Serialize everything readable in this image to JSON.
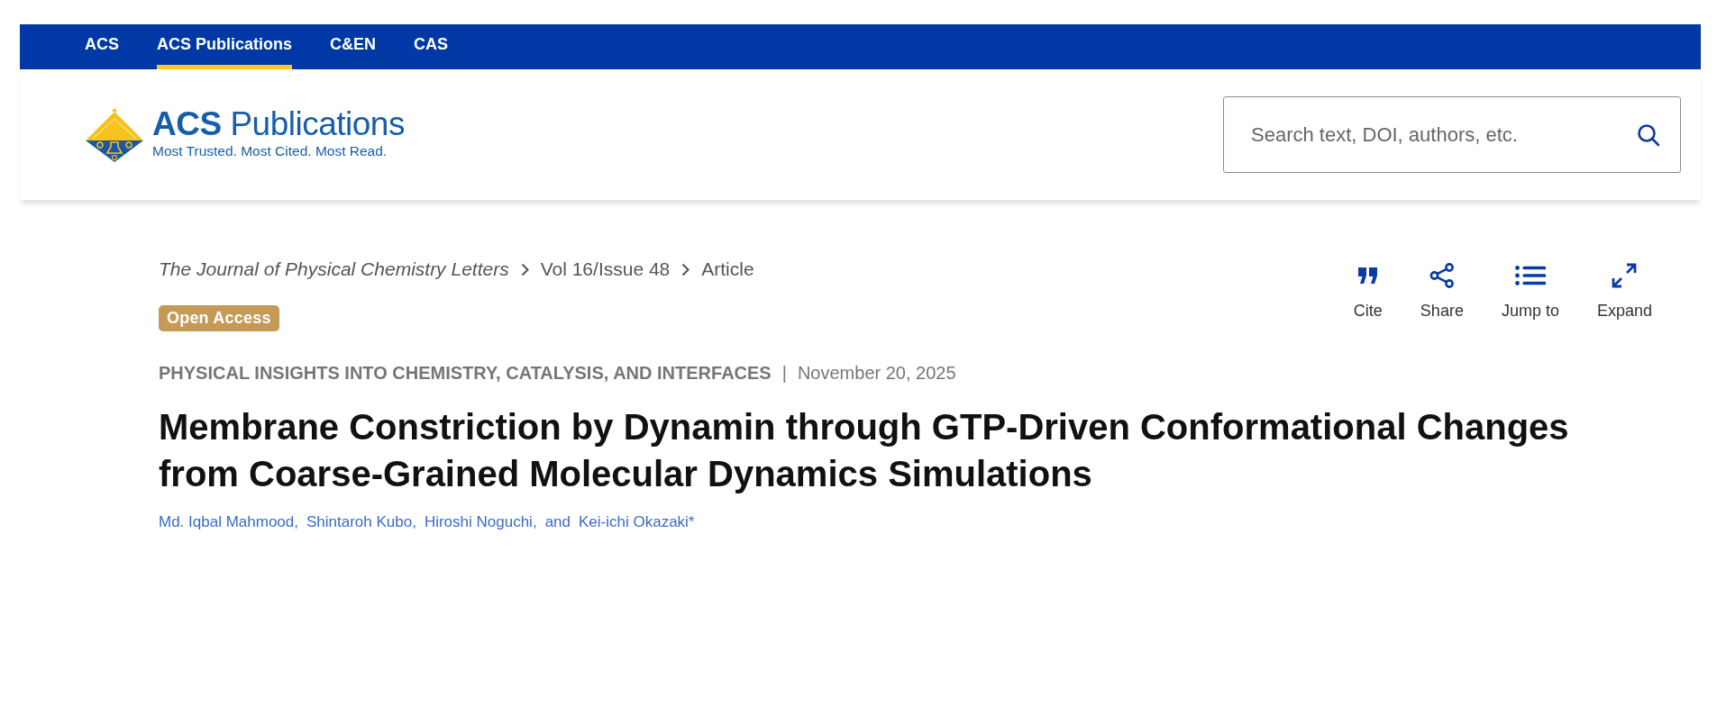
{
  "top_nav": [
    {
      "label": "ACS",
      "selected": false
    },
    {
      "label": "ACS Publications",
      "selected": true
    },
    {
      "label": "C&EN",
      "selected": false
    },
    {
      "label": "CAS",
      "selected": false
    }
  ],
  "header": {
    "logo": {
      "wordmark": "**ACS** Publications",
      "tagline": "Most Trusted. Most Cited. Most Read."
    },
    "search": {
      "placeholder": "Search text, DOI, authors, etc."
    }
  },
  "breadcrumb": [
    {
      "label": "The Journal of Physical Chemistry Letters",
      "kind": "journal"
    },
    {
      "label": "Vol 16/Issue 48",
      "kind": "issue"
    },
    {
      "label": "Article",
      "kind": "current"
    }
  ],
  "actions": [
    {
      "label": "Cite",
      "kind": "cite"
    },
    {
      "label": "Share",
      "kind": "share"
    },
    {
      "label": "Jump to",
      "kind": "jump"
    },
    {
      "label": "Expand",
      "kind": "expand"
    }
  ],
  "article": {
    "access_badge": "Open Access",
    "section": "PHYSICAL INSIGHTS INTO CHEMISTRY, CATALYSIS, AND INTERFACES",
    "separator": "|",
    "date": "November 20, 2025",
    "title": "Membrane Constriction by Dynamin through GTP-Driven Conformational Changes from Coarse-Grained Molecular Dynamics Simulations",
    "authors": [
      "Md. Iqbal Mahmood,",
      "Shintaroh Kubo,",
      "Hiroshi Noguchi,",
      "Kei-ichi Okazaki*"
    ],
    "author_conjunction": "and"
  }
}
